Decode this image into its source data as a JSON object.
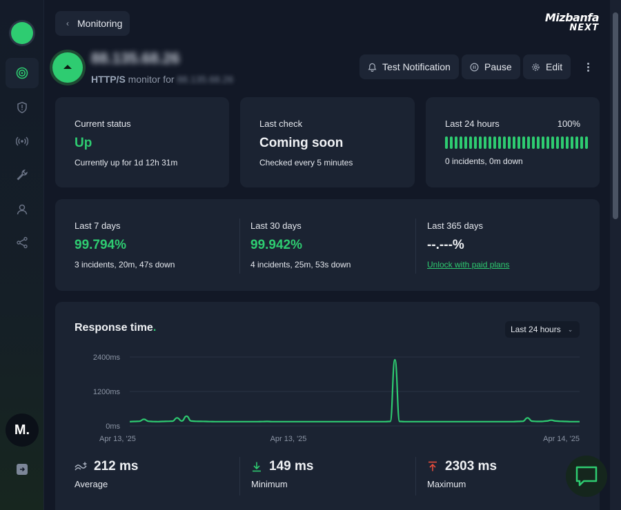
{
  "nav": {
    "back_label": "Monitoring",
    "brand_line1": "Mizbanfa",
    "brand_line2": "NEXT",
    "avatar_initial": "M.",
    "items": [
      "monitors",
      "incidents",
      "status-pages",
      "maintenance",
      "team",
      "integrations"
    ]
  },
  "monitor": {
    "host": "88.135.68.26",
    "protocol": "HTTP/S",
    "subtitle_mid": " monitor for ",
    "host_small": "88.135.68.26"
  },
  "actions": {
    "test_notification": "Test Notification",
    "pause": "Pause",
    "edit": "Edit"
  },
  "status_cards": {
    "current": {
      "label": "Current status",
      "value": "Up",
      "detail": "Currently up for 1d 12h 31m"
    },
    "last_check": {
      "label": "Last check",
      "value": "Coming soon",
      "detail": "Checked every 5 minutes"
    },
    "last24": {
      "label": "Last 24 hours",
      "percent": "100%",
      "detail": "0 incidents, 0m down",
      "bars": 30
    }
  },
  "uptime": {
    "d7": {
      "label": "Last 7 days",
      "value": "99.794%",
      "detail": "3 incidents, 20m, 47s down"
    },
    "d30": {
      "label": "Last 30 days",
      "value": "99.942%",
      "detail": "4 incidents, 25m, 53s down"
    },
    "d365": {
      "label": "Last 365 days",
      "value": "--.---%",
      "detail": "Unlock with paid plans"
    }
  },
  "response": {
    "title": "Response time",
    "title_dot": ".",
    "range": "Last 24 hours",
    "stats": {
      "average": {
        "value": "212 ms",
        "label": "Average"
      },
      "minimum": {
        "value": "149 ms",
        "label": "Minimum"
      },
      "maximum": {
        "value": "2303 ms",
        "label": "Maximum"
      }
    }
  },
  "colors": {
    "accent": "#2ecc71",
    "danger": "#e74c3c",
    "card": "#1b2332",
    "bg": "#121826"
  },
  "chart_data": {
    "type": "line",
    "title": "Response time",
    "x_ticks": [
      "Apr 13, '25",
      "Apr 13, '25",
      "Apr 14, '25"
    ],
    "y_ticks": [
      "2400ms",
      "1200ms",
      "0ms"
    ],
    "ylim": [
      0,
      2400
    ],
    "grid": true,
    "series": [
      {
        "color": "#2ecc71",
        "values": [
          150,
          155,
          160,
          230,
          160,
          152,
          150,
          155,
          160,
          165,
          280,
          170,
          340,
          170,
          160,
          158,
          155,
          152,
          150,
          150,
          150,
          150,
          150,
          150,
          150,
          150,
          150,
          150,
          152,
          155,
          150,
          150,
          150,
          150,
          150,
          150,
          150,
          150,
          150,
          150,
          150,
          150,
          150,
          150,
          150,
          150,
          150,
          150,
          150,
          150,
          150,
          150,
          150,
          150,
          150,
          155,
          2303,
          155,
          150,
          150,
          150,
          150,
          150,
          150,
          150,
          150,
          150,
          150,
          150,
          150,
          150,
          150,
          150,
          150,
          150,
          150,
          150,
          150,
          150,
          150,
          150,
          150,
          155,
          160,
          280,
          165,
          155,
          155,
          170,
          200,
          170,
          160,
          155,
          150,
          150,
          150
        ]
      }
    ]
  }
}
